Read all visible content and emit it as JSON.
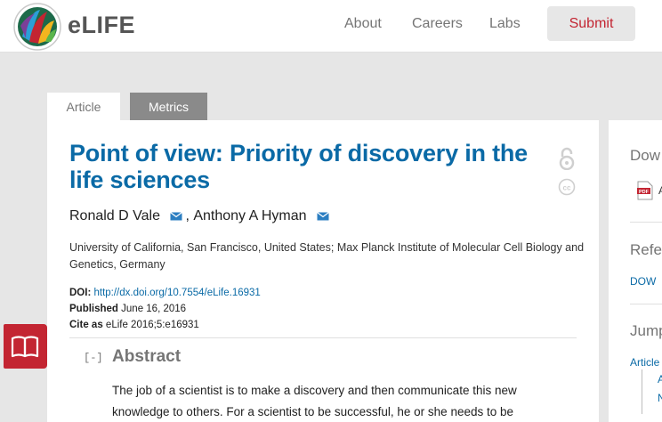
{
  "header": {
    "logo_text": "eLIFE",
    "nav": {
      "about": "About",
      "careers": "Careers",
      "labs": "Labs"
    },
    "submit_label": "Submit"
  },
  "tabs": {
    "article": "Article",
    "metrics": "Metrics"
  },
  "article": {
    "title": "Point of view: Priority of discovery in the life sciences",
    "authors": [
      {
        "name": "Ronald D Vale",
        "separator": ","
      },
      {
        "name": "Anthony A Hyman",
        "separator": ""
      }
    ],
    "affiliations": "University of California, San Francisco, United States; Max Planck Institute of Molecular Cell Biology and Genetics, Germany",
    "doi_label": "DOI:",
    "doi_value": "http://dx.doi.org/10.7554/eLife.16931",
    "published_label": "Published",
    "published_value": "June 16, 2016",
    "cite_label": "Cite as",
    "cite_value": "eLife 2016;5:e16931",
    "abstract_toggle": "[-]",
    "abstract_heading": "Abstract",
    "abstract_text": "The job of a scientist is to make a discovery and then communicate this new knowledge to others. For a scientist to be successful, he or she needs to be"
  },
  "right_panel": {
    "download_heading": "Dow",
    "pdf_label": "A",
    "references_heading": "Refe",
    "references_link": "DOW",
    "jump_heading": "Jump",
    "jump_article": "Article",
    "jump_sub1": "A",
    "jump_sub2": "N"
  },
  "colors": {
    "brand_red": "#c32532",
    "link_blue": "#0a6aa6",
    "page_grey": "#e6e6e6"
  },
  "icons": [
    "elife-logo-icon",
    "open-access-icon",
    "creative-commons-icon",
    "mail-icon",
    "book-reader-icon",
    "pdf-icon"
  ]
}
